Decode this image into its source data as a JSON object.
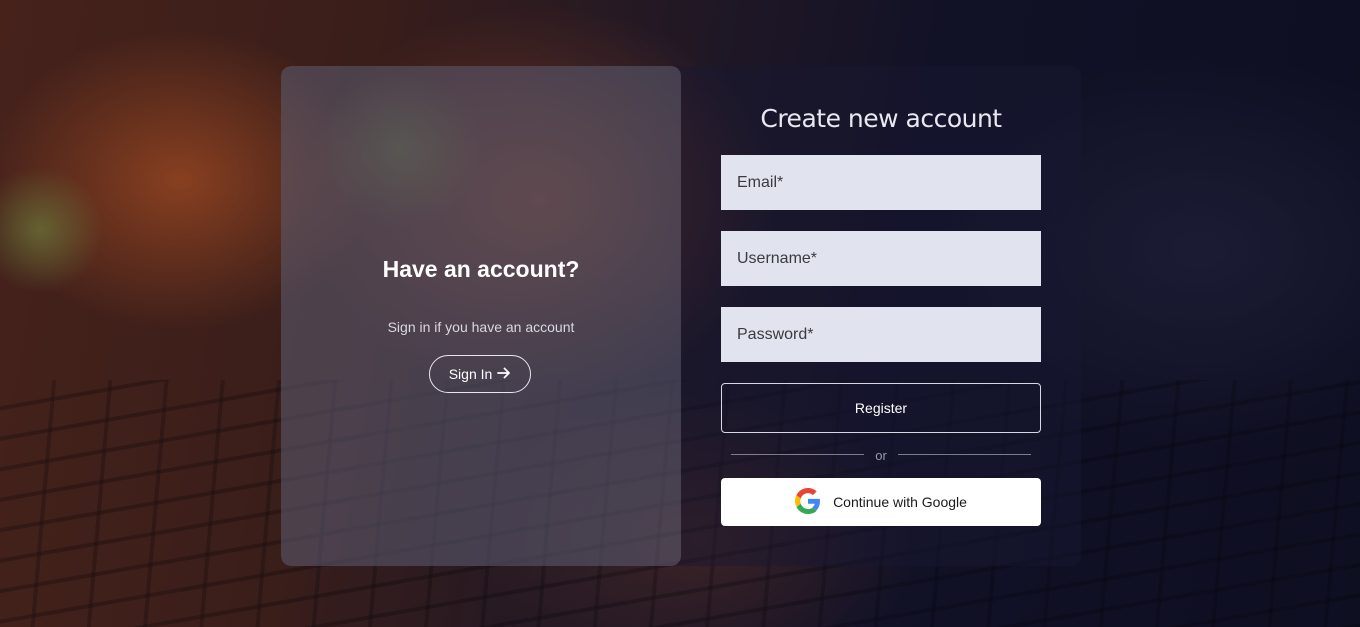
{
  "left": {
    "title": "Have an account?",
    "subtitle": "Sign in if you have an account",
    "signin_label": "Sign In",
    "signin_icon": "arrow-right-icon"
  },
  "right": {
    "title": "Create new account",
    "email_placeholder": "Email*",
    "username_placeholder": "Username*",
    "password_placeholder": "Password*",
    "register_label": "Register",
    "divider_text": "or",
    "google_label": "Continue with Google",
    "google_icon": "google-logo-icon"
  },
  "colors": {
    "field_bg": "#e1e3ee",
    "google_blue": "#4285F4",
    "google_red": "#EA4335",
    "google_yellow": "#FBBC05",
    "google_green": "#34A853"
  }
}
